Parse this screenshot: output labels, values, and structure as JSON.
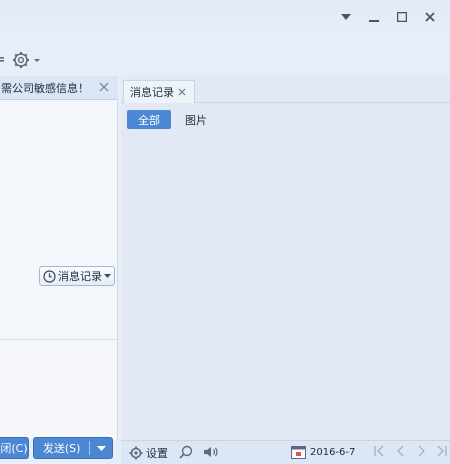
{
  "window": {
    "controls": [
      "menu-dropdown",
      "minimize",
      "maximize",
      "close"
    ]
  },
  "toolbar": {
    "settings_icon": "gear-icon"
  },
  "left": {
    "notice_text": "需公司敏感信息！",
    "message_record_button": "消息记录",
    "close_button": "闭(C)",
    "send_button": "发送(S)"
  },
  "right": {
    "tab_label": "消息记录",
    "filter_all": "全部",
    "filter_images": "图片"
  },
  "status_bar": {
    "settings_label": "设置",
    "date": "2016-6-7"
  },
  "colors": {
    "accent": "#4c87d3",
    "panel_bg": "#e2e9f5",
    "notice_bg": "#dbe5f4"
  }
}
